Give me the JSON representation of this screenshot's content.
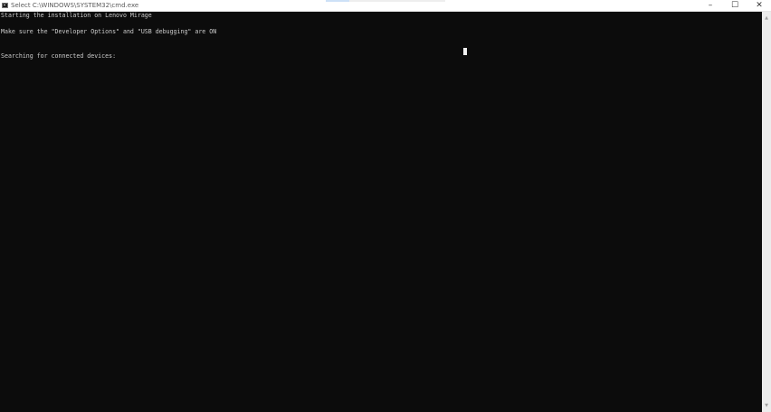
{
  "window": {
    "title": "Select C:\\WINDOWS\\SYSTEM32\\cmd.exe",
    "controls": {
      "minimize": "–",
      "maximize": "☐",
      "close": "✕"
    }
  },
  "console": {
    "lines": [
      "Starting the installation on Lenovo Mirage",
      "Make sure the \"Developer Options\" and \"USB debugging\" are ON",
      "Searching for connected devices:"
    ],
    "colors": {
      "background": "#0c0c0c",
      "text": "#cccccc",
      "cursor": "#f2f2f2"
    }
  },
  "scrollbar": {
    "up_arrow": "▲",
    "down_arrow": "▼"
  }
}
